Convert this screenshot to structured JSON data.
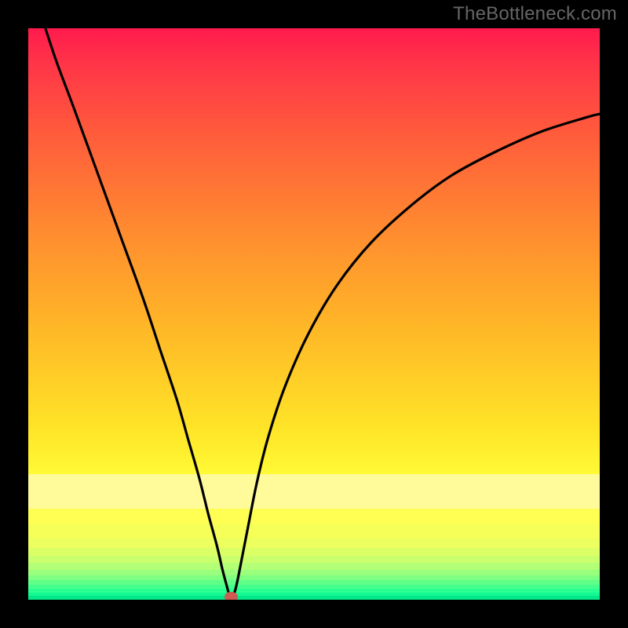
{
  "watermark": "TheBottleneck.com",
  "colors": {
    "black": "#000000",
    "curve": "#000000",
    "marker": "#ce5b53",
    "gradient_top": "#ff1a4d",
    "gradient_mid": "#ffe427",
    "gradient_bottom": "#00e88a"
  },
  "chart_data": {
    "type": "line",
    "title": "",
    "xlabel": "",
    "ylabel": "",
    "xlim": [
      0,
      100
    ],
    "ylim": [
      0,
      100
    ],
    "series": [
      {
        "name": "bottleneck-curve",
        "x": [
          3,
          5,
          8,
          12,
          16,
          20,
          23,
          26,
          28,
          30,
          31.5,
          33,
          34,
          34.8,
          35.3,
          35.8,
          36.4,
          37.3,
          38.5,
          40,
          42,
          45,
          49,
          54,
          60,
          67,
          74,
          82,
          90,
          98,
          100
        ],
        "y": [
          100,
          94,
          86,
          75,
          64,
          53,
          44,
          35,
          28,
          21,
          15,
          9.5,
          5.2,
          2.2,
          0.5,
          0.6,
          2.4,
          6.8,
          13,
          20.5,
          28.5,
          37.5,
          46.5,
          55,
          62.5,
          69,
          74.2,
          78.5,
          82,
          84.5,
          85
        ]
      }
    ],
    "marker": {
      "x": 35.5,
      "y": 0.5,
      "shape": "ellipse"
    },
    "background": "vertical-gradient-red-to-green",
    "grid": false,
    "legend": false
  }
}
